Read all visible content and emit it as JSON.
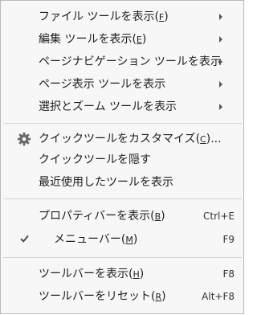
{
  "menu": {
    "items": [
      {
        "label": "ファイル ツールを表示(",
        "mnemonic": "F",
        "suffix": ")",
        "submenu": true
      },
      {
        "label": "編集 ツールを表示(",
        "mnemonic": "E",
        "suffix": ")",
        "submenu": true
      },
      {
        "label": "ページナビゲーション ツールを表示",
        "mnemonic": "",
        "suffix": "",
        "submenu": true
      },
      {
        "label": "ページ表示 ツールを表示",
        "mnemonic": "",
        "suffix": "",
        "submenu": true
      },
      {
        "label": "選択とズーム ツールを表示",
        "mnemonic": "",
        "suffix": "",
        "submenu": true
      },
      {
        "label": "クイックツールをカスタマイズ(",
        "mnemonic": "C",
        "suffix": ")...",
        "icon": "gear-icon"
      },
      {
        "label": "クイックツールを隠す",
        "mnemonic": "",
        "suffix": ""
      },
      {
        "label": "最近使用したツールを表示",
        "mnemonic": "",
        "suffix": ""
      },
      {
        "label": "プロパティバーを表示(",
        "mnemonic": "B",
        "suffix": ")",
        "shortcut": "Ctrl+E"
      },
      {
        "label": "メニューバー(",
        "mnemonic": "M",
        "suffix": ")",
        "shortcut": "F9",
        "checked": true,
        "icon": "check-icon"
      },
      {
        "label": "ツールバーを表示(",
        "mnemonic": "H",
        "suffix": ")",
        "shortcut": "F8"
      },
      {
        "label": "ツールバーをリセット(",
        "mnemonic": "R",
        "suffix": ")",
        "shortcut": "Alt+F8"
      }
    ]
  },
  "colors": {
    "background": "#f7f7f7",
    "border": "#b9b9b9",
    "separator": "#d6d6d6",
    "text": "#1e1e1e"
  }
}
